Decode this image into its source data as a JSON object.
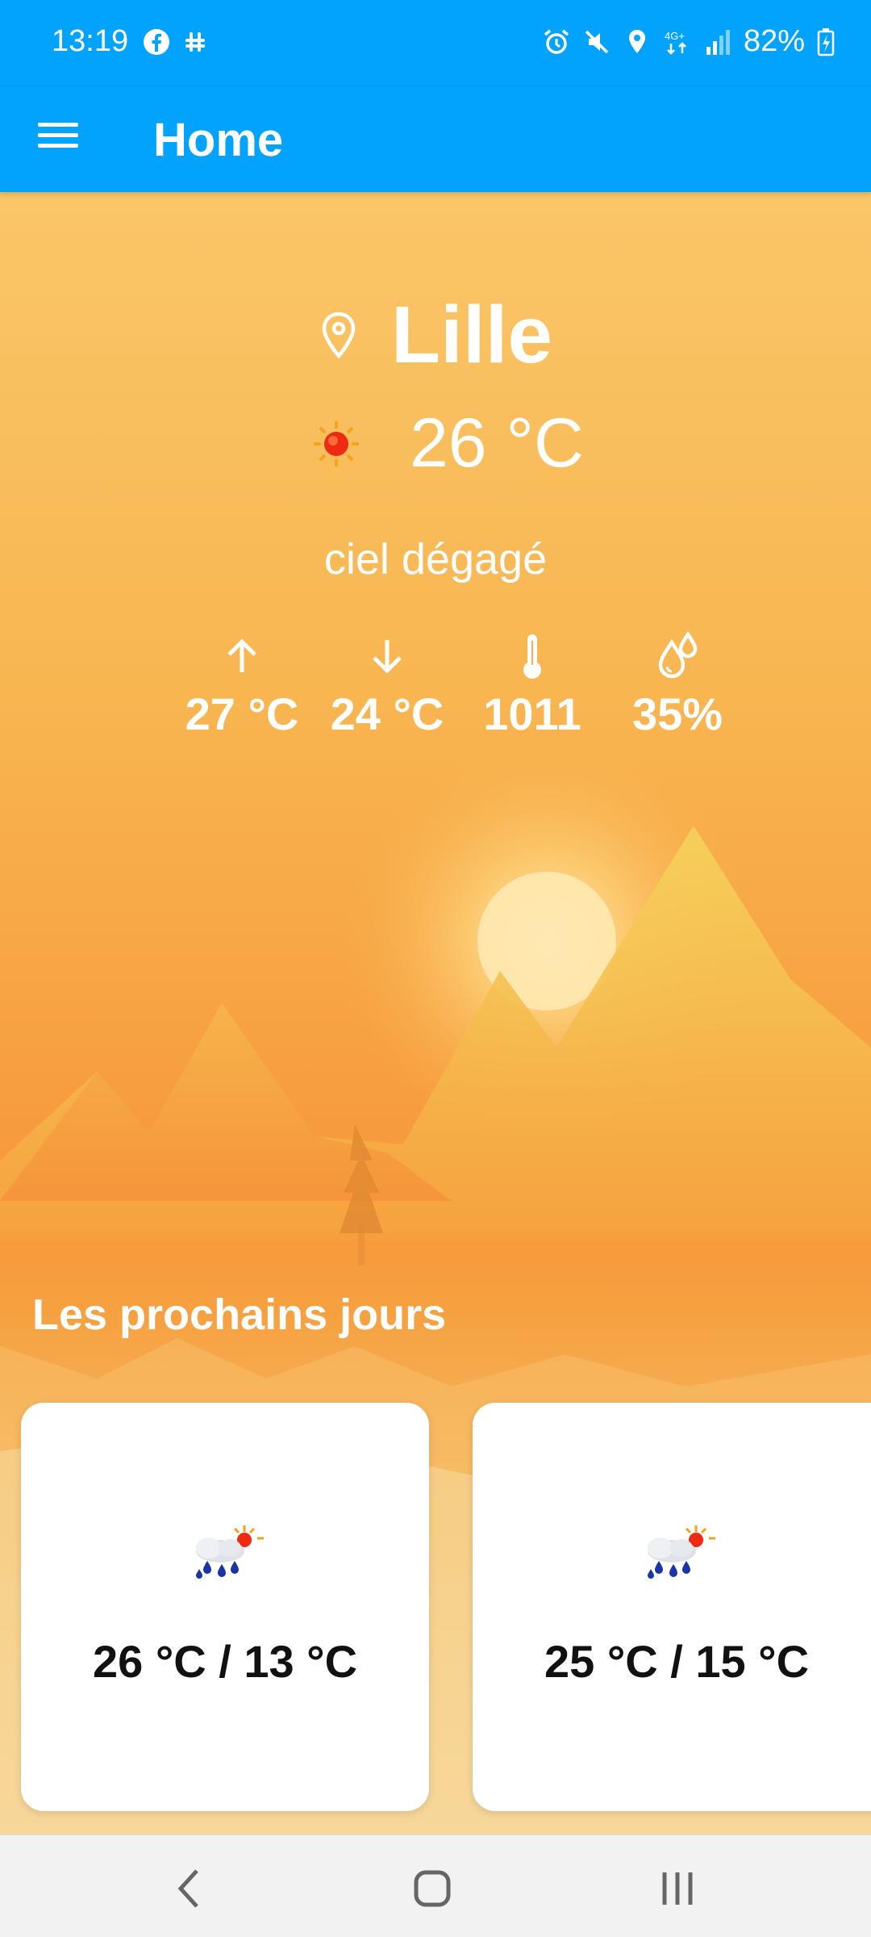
{
  "status_bar": {
    "time": "13:19",
    "left_icons": [
      "facebook-icon",
      "slack-icon"
    ],
    "right_icons": [
      "alarm-icon",
      "mute-icon",
      "location-icon",
      "4g-icon",
      "signal-icon"
    ],
    "battery": "82%"
  },
  "app_bar": {
    "title": "Home",
    "menu_icon": "hamburger-menu-icon"
  },
  "current": {
    "city": "Lille",
    "temperature": "26 °C",
    "description": "ciel dégagé",
    "stats": [
      {
        "icon": "arrow-up-icon",
        "value": "27 °C"
      },
      {
        "icon": "arrow-down-icon",
        "value": "24 °C"
      },
      {
        "icon": "thermometer-icon",
        "value": "1011"
      },
      {
        "icon": "humidity-icon",
        "value": "35%"
      }
    ]
  },
  "forecast": {
    "title": "Les prochains jours",
    "days": [
      {
        "icon": "rain-sun-cloud-icon",
        "range": "26 °C / 13 °C"
      },
      {
        "icon": "rain-sun-cloud-icon",
        "range": "25 °C / 15 °C"
      }
    ]
  },
  "nav_bar": {
    "buttons": [
      "back-icon",
      "home-icon",
      "recents-icon"
    ]
  },
  "colors": {
    "primary": "#01a3fd",
    "sky_top": "#fac668",
    "sky_mid": "#f79a3e"
  }
}
